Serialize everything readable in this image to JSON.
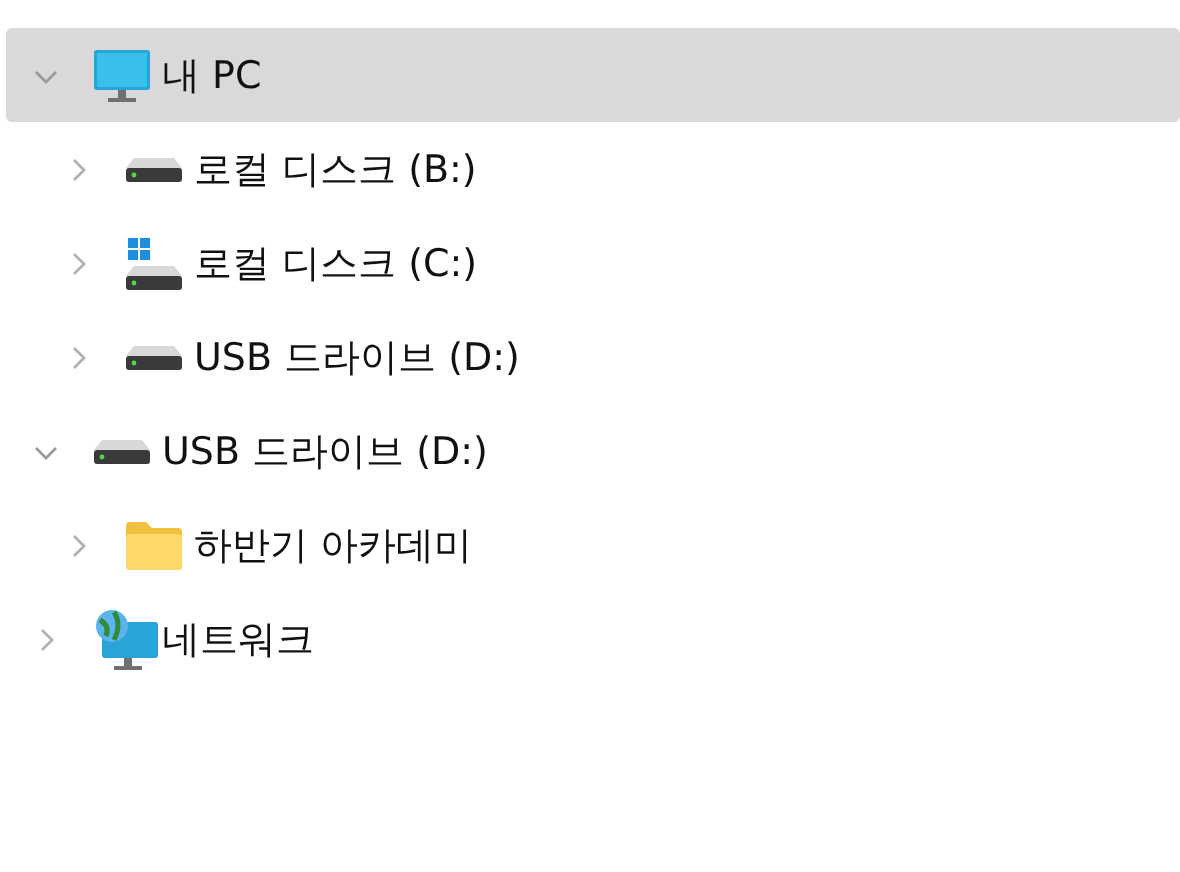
{
  "tree": [
    {
      "label": "내 PC",
      "kind": "pc",
      "expanded": true,
      "selected": true,
      "children": [
        {
          "label": "로컬 디스크 (B:)",
          "kind": "drive",
          "expanded": false,
          "selected": false
        },
        {
          "label": "로컬 디스크 (C:)",
          "kind": "system-drive",
          "expanded": false,
          "selected": false
        },
        {
          "label": "USB 드라이브 (D:)",
          "kind": "drive",
          "expanded": false,
          "selected": false
        }
      ]
    },
    {
      "label": "USB 드라이브 (D:)",
      "kind": "drive",
      "expanded": true,
      "selected": false,
      "children": [
        {
          "label": "하반기 아카데미",
          "kind": "folder",
          "expanded": false,
          "selected": false
        }
      ]
    },
    {
      "label": "네트워크",
      "kind": "network",
      "expanded": false,
      "selected": false
    }
  ]
}
